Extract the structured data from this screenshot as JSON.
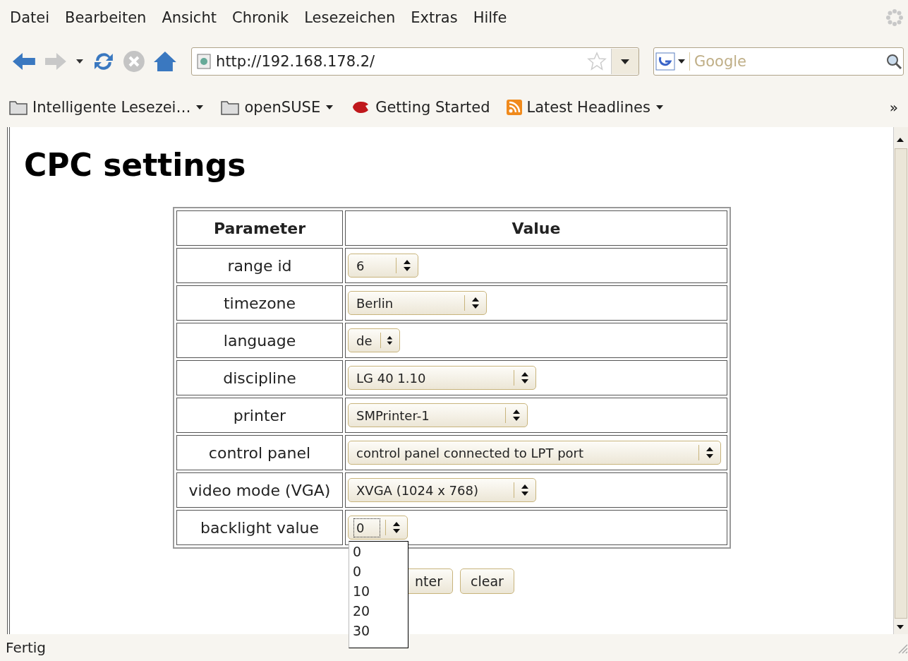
{
  "menu": [
    "Datei",
    "Bearbeiten",
    "Ansicht",
    "Chronik",
    "Lesezeichen",
    "Extras",
    "Hilfe"
  ],
  "address_bar": {
    "value": "http://192.168.178.2/"
  },
  "search": {
    "placeholder": "Google"
  },
  "bookmarks": [
    {
      "label": "Intelligente Lesezei…",
      "kind": "folder",
      "dropdown": true
    },
    {
      "label": "openSUSE",
      "kind": "folder",
      "dropdown": true
    },
    {
      "label": "Getting Started",
      "kind": "page",
      "dropdown": false
    },
    {
      "label": "Latest Headlines",
      "kind": "feed",
      "dropdown": true
    }
  ],
  "bookmarks_overflow": "»",
  "page": {
    "title": "CPC settings",
    "table": {
      "columns": [
        "Parameter",
        "Value"
      ],
      "rows": [
        {
          "parameter": "range id",
          "value": "6",
          "focused": false
        },
        {
          "parameter": "timezone",
          "value": "Berlin",
          "focused": false
        },
        {
          "parameter": "language",
          "value": "de",
          "focused": false
        },
        {
          "parameter": "discipline",
          "value": "LG 40 1.10",
          "focused": false
        },
        {
          "parameter": "printer",
          "value": "SMPrinter-1",
          "focused": false
        },
        {
          "parameter": "control panel",
          "value": "control panel connected to LPT port",
          "focused": false
        },
        {
          "parameter": "video mode (VGA)",
          "value": "XVGA (1024 x 768)",
          "focused": false
        },
        {
          "parameter": "backlight value",
          "value": "0",
          "focused": true
        }
      ]
    },
    "buttons": [
      "nter",
      "clear"
    ],
    "open_dropdown": {
      "open": true,
      "options": [
        "0",
        "0",
        "10",
        "20",
        "30"
      ]
    }
  },
  "status_bar": "Fertig"
}
